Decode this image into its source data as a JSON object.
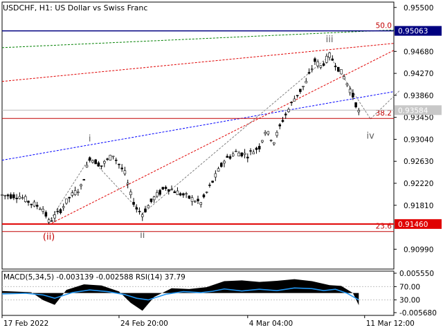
{
  "header": {
    "symbol": "USDCHF",
    "timeframe": "H1:",
    "description": "US Dollar vs Swiss Franc"
  },
  "colors": {
    "background": "#ffffff",
    "candles": "#000000",
    "axis": "#000000",
    "price_tag_blue": "#000080",
    "price_tag_red": "#e00000",
    "fib_line": "#c00000",
    "current_line": "#b8b8b8",
    "trend_blue": "#0000ff",
    "trend_red": "#e00000",
    "trend_green": "#008000",
    "wave_label_red": "#c00000",
    "wave_label_grey": "#606060",
    "macd_fill": "#000000",
    "rsi_line": "#2196f3"
  },
  "chart_data": [
    {
      "type": "candlestick",
      "title": "USDCHF, H1: US Dollar vs Swiss Franc",
      "y_axis_position": "right",
      "ylim": [
        0.9062,
        0.956
      ],
      "y_ticks": [
        "0.95500",
        "0.94680",
        "0.94270",
        "0.93860",
        "0.93450",
        "0.93040",
        "0.92630",
        "0.92220",
        "0.91810",
        "0.90990"
      ],
      "x_ticks": [
        "17 Feb 2022",
        "24 Feb 20:00",
        "4 Mar 04:00",
        "11 Mar 12:00"
      ],
      "price_tags": [
        {
          "value": "0.95063",
          "color": "blue"
        },
        {
          "value": "0.93584",
          "color": "grey"
        },
        {
          "value": "0.91460",
          "color": "red"
        }
      ],
      "fibonacci_levels": [
        {
          "label": "50.0",
          "price": 0.95063
        },
        {
          "label": "38.2",
          "price": 0.9343
        },
        {
          "label": "23.6",
          "price": 0.9132
        }
      ],
      "wave_labels": [
        {
          "label": "(ii)",
          "color": "red"
        },
        {
          "label": "i",
          "color": "grey"
        },
        {
          "label": "ii",
          "color": "grey"
        },
        {
          "label": "iii",
          "color": "grey"
        },
        {
          "label": "iv",
          "color": "grey"
        }
      ],
      "path_points": [
        [
          0,
          0.92
        ],
        [
          6,
          0.9198
        ],
        [
          10,
          0.9185
        ],
        [
          14,
          0.9175
        ],
        [
          16,
          0.915
        ],
        [
          19,
          0.9165
        ],
        [
          23,
          0.9195
        ],
        [
          27,
          0.9215
        ],
        [
          30,
          0.927
        ],
        [
          34,
          0.9255
        ],
        [
          38,
          0.9275
        ],
        [
          42,
          0.924
        ],
        [
          44,
          0.92
        ],
        [
          46,
          0.9175
        ],
        [
          48,
          0.9165
        ],
        [
          52,
          0.9195
        ],
        [
          56,
          0.9215
        ],
        [
          60,
          0.9205
        ],
        [
          64,
          0.9195
        ],
        [
          68,
          0.9185
        ],
        [
          72,
          0.9225
        ],
        [
          76,
          0.9265
        ],
        [
          80,
          0.928
        ],
        [
          84,
          0.9275
        ],
        [
          88,
          0.929
        ],
        [
          90,
          0.932
        ],
        [
          93,
          0.93
        ],
        [
          96,
          0.934
        ],
        [
          100,
          0.938
        ],
        [
          104,
          0.941
        ],
        [
          107,
          0.945
        ],
        [
          109,
          0.944
        ],
        [
          112,
          0.946
        ],
        [
          114,
          0.9445
        ],
        [
          117,
          0.942
        ],
        [
          120,
          0.9385
        ],
        [
          122,
          0.9355
        ]
      ]
    },
    {
      "type": "line",
      "title": "MACD(5,34,5) -0.003139 -0.002588 RSI(14) 37.79",
      "macd_params": "(5,34,5)",
      "macd_value": -0.003139,
      "signal_value": -0.002588,
      "rsi_period": 14,
      "rsi_value": 37.79,
      "y_ticks_right": [
        "0.005550",
        "70.00",
        "30.00",
        "-0.005680"
      ],
      "rsi_levels": [
        70,
        30
      ],
      "ylim": [
        -0.00568,
        0.00555
      ],
      "series": [
        {
          "name": "RSI(14)",
          "x": [
            0,
            8,
            14,
            18,
            24,
            30,
            36,
            42,
            46,
            50,
            56,
            62,
            68,
            72,
            76,
            82,
            88,
            94,
            100,
            106,
            110,
            114,
            118,
            122
          ],
          "y": [
            48,
            50,
            45,
            35,
            52,
            60,
            55,
            46,
            35,
            30,
            47,
            55,
            52,
            56,
            63,
            57,
            62,
            58,
            66,
            64,
            58,
            62,
            50,
            30
          ]
        }
      ],
      "macd_histogram": {
        "x": [
          0,
          10,
          14,
          18,
          22,
          28,
          34,
          40,
          44,
          48,
          52,
          58,
          64,
          70,
          76,
          82,
          88,
          94,
          100,
          106,
          112,
          116,
          120,
          122
        ],
        "values": [
          0.0005,
          0.0002,
          -0.0018,
          -0.003,
          0.0008,
          0.0022,
          0.0019,
          0.0004,
          -0.0025,
          -0.0045,
          -0.001,
          0.0012,
          0.001,
          0.0015,
          0.003,
          0.0032,
          0.0028,
          0.0031,
          0.0035,
          0.003,
          0.002,
          0.0018,
          0.0,
          -0.0031
        ]
      }
    }
  ]
}
